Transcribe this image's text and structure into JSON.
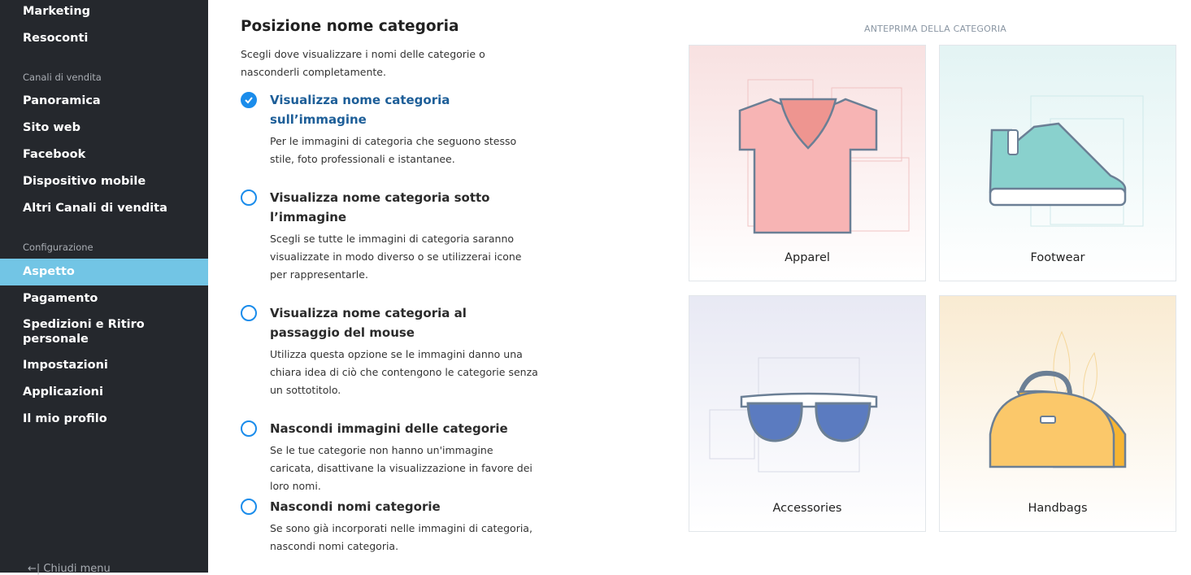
{
  "sidebar": {
    "items_top": [
      {
        "label": "Marketing"
      },
      {
        "label": "Resoconti"
      }
    ],
    "section_sales": "Canali di vendita",
    "sales_items": [
      {
        "label": "Panoramica"
      },
      {
        "label": "Sito web"
      },
      {
        "label": "Facebook"
      },
      {
        "label": "Dispositivo mobile"
      },
      {
        "label": "Altri Canali di vendita"
      }
    ],
    "section_config": "Configurazione",
    "config_items": [
      {
        "label": "Aspetto",
        "active": true
      },
      {
        "label": "Pagamento"
      },
      {
        "label": "Spedizioni e Ritiro personale"
      },
      {
        "label": "Impostazioni"
      },
      {
        "label": "Applicazioni"
      },
      {
        "label": "Il mio profilo"
      }
    ],
    "close_menu": "Chiudi menu",
    "active_color": "#72c5e5"
  },
  "main": {
    "title": "Posizione nome categoria",
    "intro": "Scegli dove visualizzare i nomi delle categorie o nasconderli completamente.",
    "options": [
      {
        "title": "Visualizza nome categoria sull’immagine",
        "desc": "Per le immagini di categoria che seguono stesso stile, foto professionali e istantanee.",
        "selected": true
      },
      {
        "title": "Visualizza nome categoria sotto l’immagine",
        "desc": "Scegli se tutte le immagini di categoria saranno visualizzate in modo diverso o se utilizzerai icone per rappresentarle.",
        "selected": false
      },
      {
        "title": "Visualizza nome categoria al passaggio del mouse",
        "desc": "Utilizza questa opzione se le immagini danno una chiara idea di ciò che contengono le categorie senza un sottotitolo.",
        "selected": false
      },
      {
        "title": "Nascondi immagini delle categorie",
        "desc": "Se le tue categorie non hanno un'immagine caricata, disattivane la visualizzazione in favore dei loro nomi.",
        "selected": false
      },
      {
        "title": "Nascondi nomi categorie",
        "desc": "Se sono già incorporati nelle immagini di categoria, nascondi nomi categoria.",
        "selected": false
      }
    ],
    "accent": "#1a8ceb"
  },
  "preview": {
    "label": "ANTEPRIMA DELLA CATEGORIA",
    "cards": [
      {
        "name": "Apparel",
        "icon": "tshirt-icon",
        "bg": "#f8e1e1"
      },
      {
        "name": "Footwear",
        "icon": "sneaker-icon",
        "bg": "#e3f4f4"
      },
      {
        "name": "Accessories",
        "icon": "sunglasses-icon",
        "bg": "#e8e9f4"
      },
      {
        "name": "Handbags",
        "icon": "handbag-icon",
        "bg": "#f9ebd2"
      }
    ]
  }
}
